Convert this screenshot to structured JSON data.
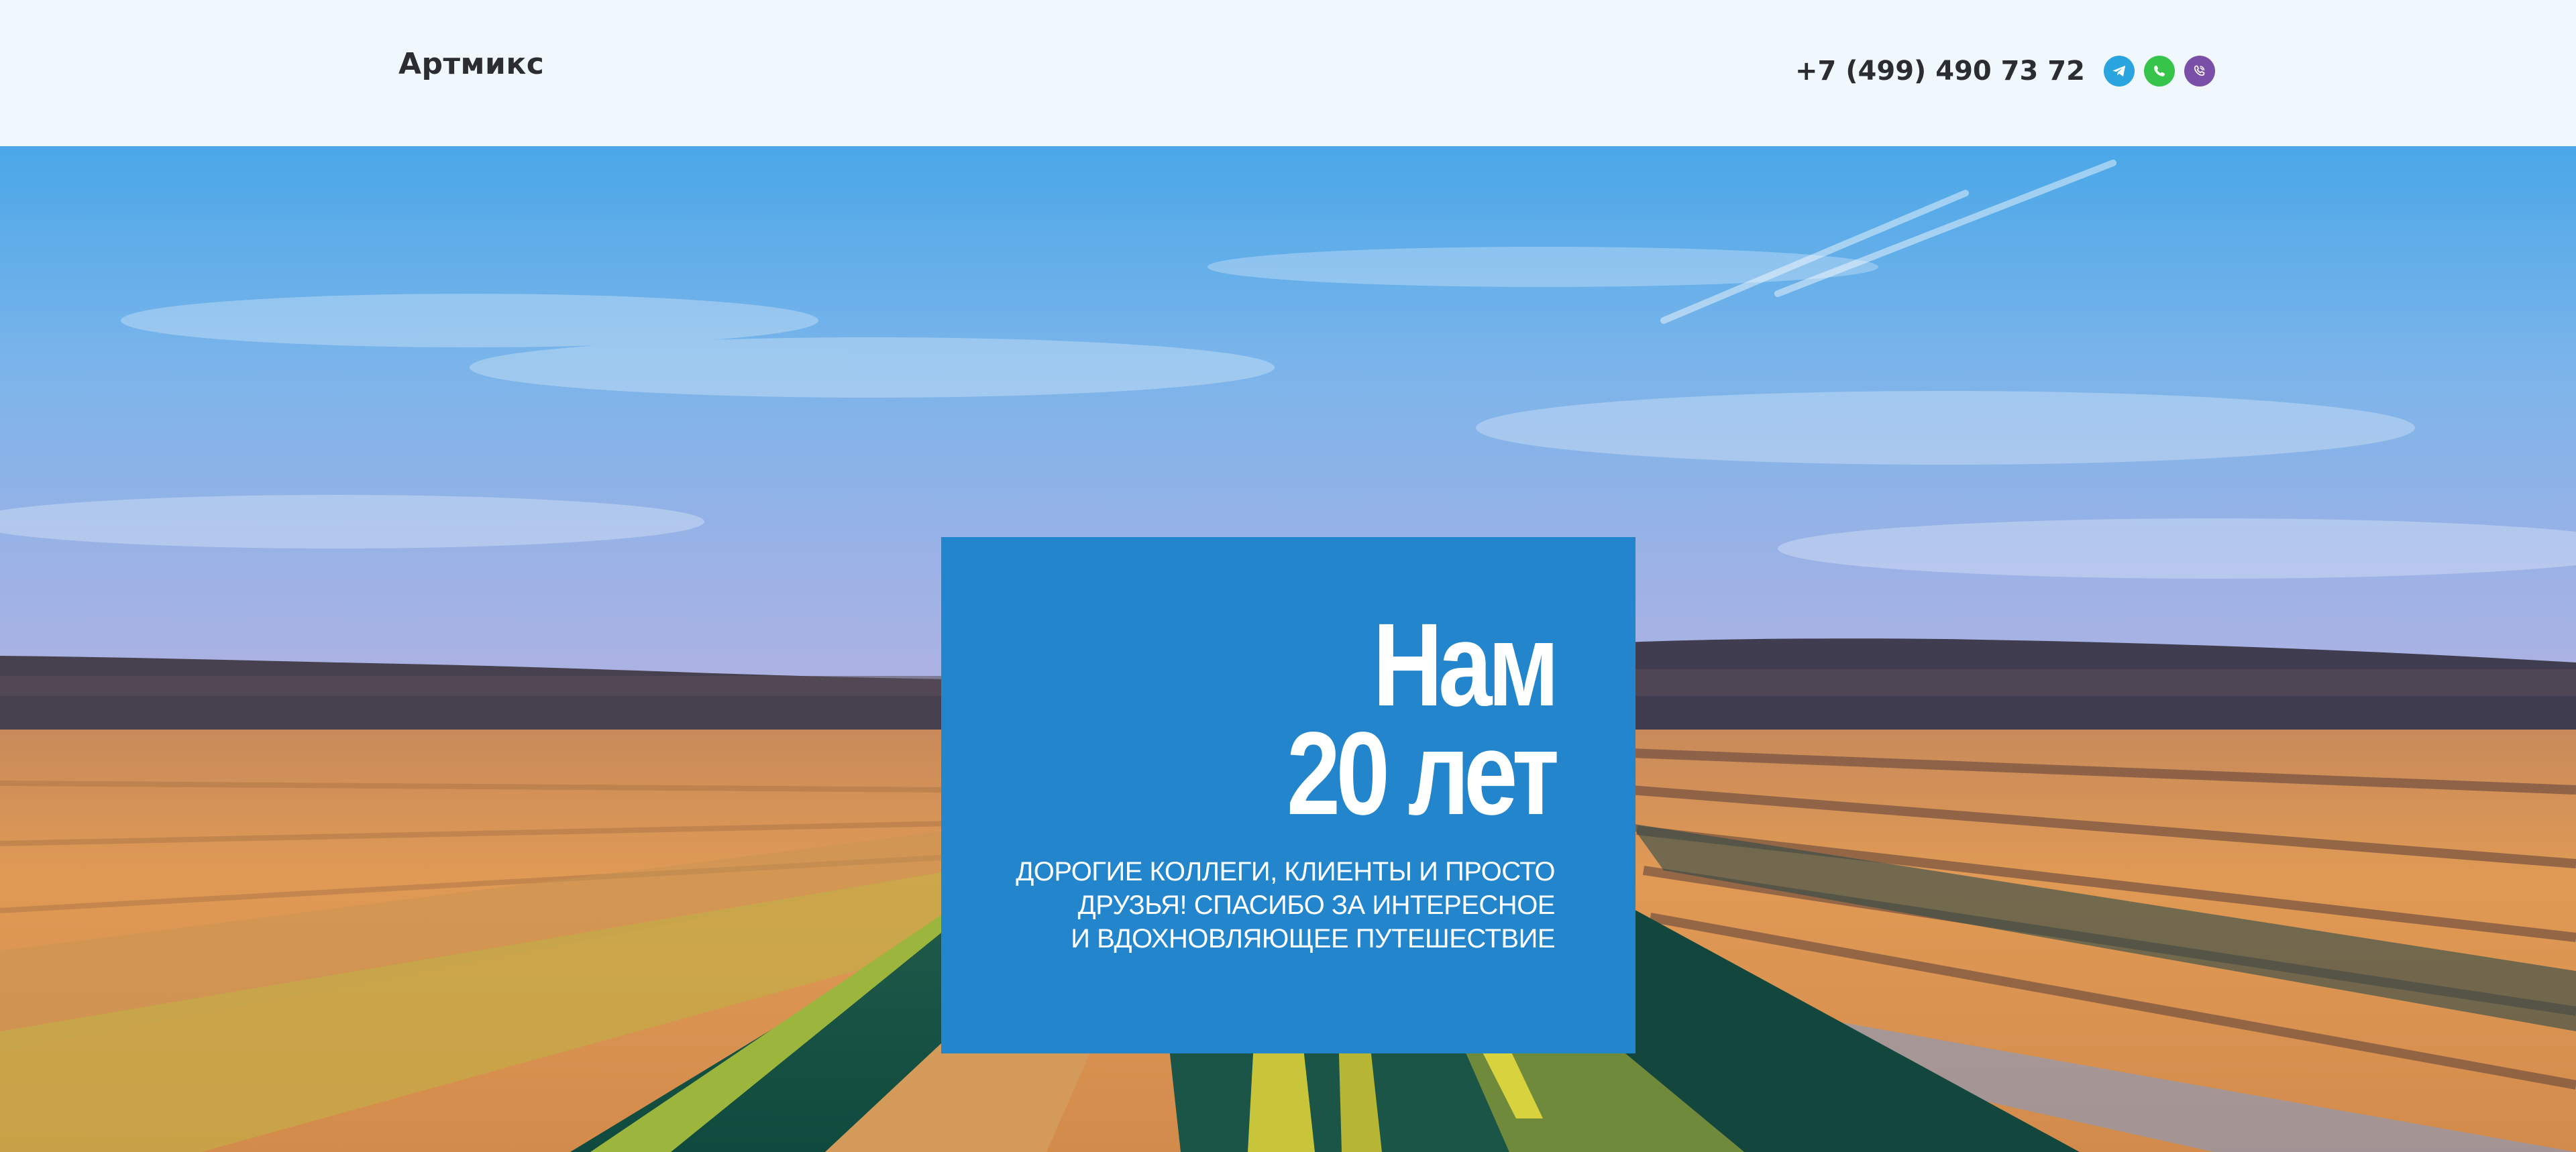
{
  "header": {
    "brand": "Артмикс",
    "phone": "+7 (499) 490 73 72",
    "messengers": [
      {
        "name": "telegram",
        "icon": "telegram-icon",
        "color": "#2aa4df"
      },
      {
        "name": "whatsapp",
        "icon": "whatsapp-icon",
        "color": "#36c54a"
      },
      {
        "name": "viber",
        "icon": "viber-icon",
        "color": "#7a4fa8"
      }
    ]
  },
  "hero": {
    "headline_line1": "Нам",
    "headline_line2": "20 лет",
    "text_line1": "ДОРОГИЕ КОЛЛЕГИ, КЛИЕНТЫ И ПРОСТО",
    "text_line2": "ДРУЗЬЯ! СПАСИБО ЗА ИНТЕРЕСНОЕ",
    "text_line3": "И ВДОХНОВЛЯЮЩЕЕ ПУТЕШЕСТВИЕ",
    "card_color": "#2386cd"
  }
}
